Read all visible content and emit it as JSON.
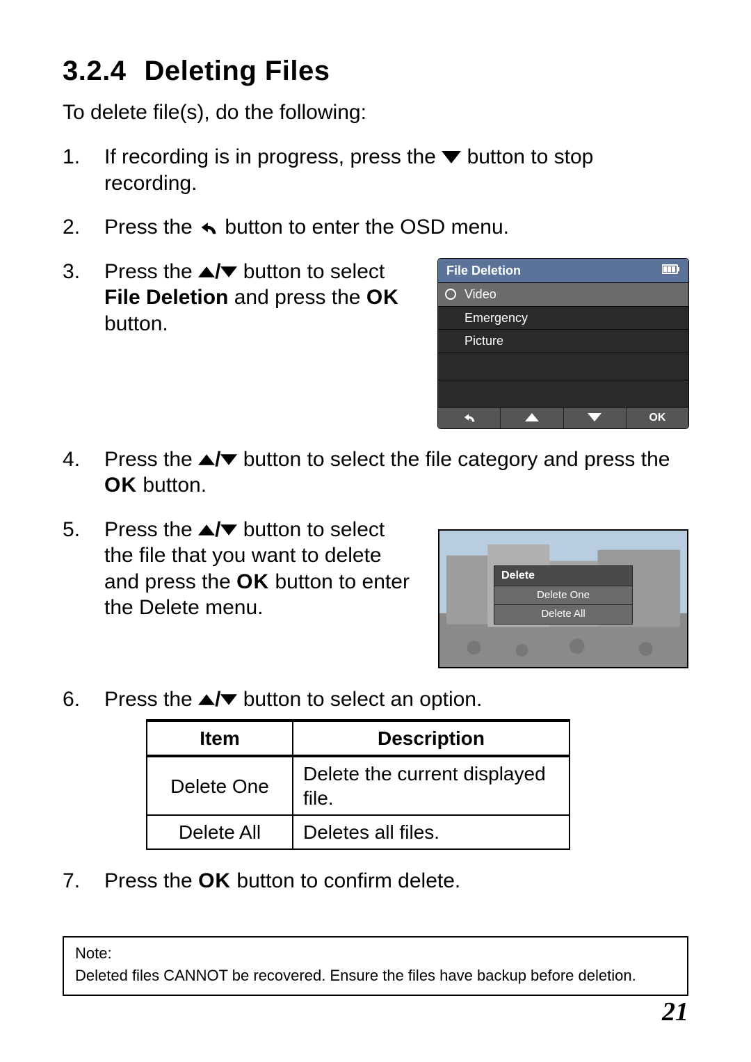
{
  "section": {
    "number": "3.2.4",
    "title": "Deleting Files"
  },
  "intro": "To delete file(s), do the following:",
  "steps": {
    "s1": {
      "pre": "If recording is in progress, press the ",
      "post": " button to stop recording."
    },
    "s2": {
      "pre": "Press the ",
      "post": " button to enter the OSD menu."
    },
    "s3": {
      "pre": "Press the ",
      "mid1": " button to select ",
      "bold": "File Deletion",
      "mid2": " and press the ",
      "ok": "OK",
      "post": " button."
    },
    "s4": {
      "pre": "Press the ",
      "mid1": " button to select the file category and press the ",
      "ok": "OK",
      "post": " button."
    },
    "s5": {
      "pre": "Press the ",
      "mid1": " button to select the file that you want to delete and press the ",
      "ok": "OK",
      "post": " button to enter the Delete menu."
    },
    "s6": {
      "pre": "Press the ",
      "post": " button to select an option."
    },
    "s7": {
      "pre": "Press the ",
      "ok": "OK",
      "post": " button to confirm delete."
    }
  },
  "screen1": {
    "title": "File Deletion",
    "items": [
      "Video",
      "Emergency",
      "Picture"
    ],
    "nav_ok": "OK"
  },
  "screen2": {
    "menu_title": "Delete",
    "options": [
      "Delete One",
      "Delete All"
    ]
  },
  "table": {
    "headers": {
      "item": "Item",
      "desc": "Description"
    },
    "rows": [
      {
        "item": "Delete One",
        "desc": "Delete the current displayed file."
      },
      {
        "item": "Delete All",
        "desc": "Deletes all files."
      }
    ]
  },
  "note": {
    "heading": "Note:",
    "body": "Deleted files CANNOT be recovered. Ensure the files have backup before deletion."
  },
  "page_number": "21"
}
